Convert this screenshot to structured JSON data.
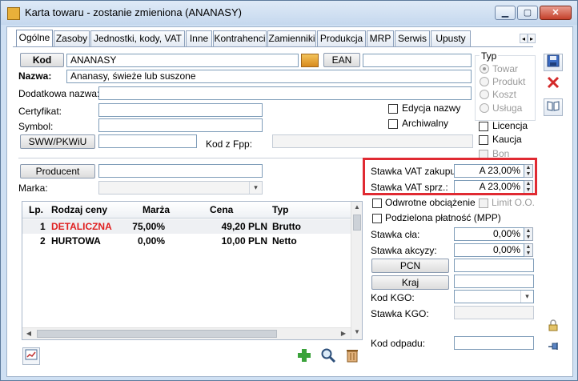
{
  "window": {
    "title": "Karta towaru - zostanie zmieniona (ANANASY)",
    "controls": {
      "minimize": "▁",
      "maximize": "▢",
      "close": "✕"
    }
  },
  "tabs": [
    "Ogólne",
    "Zasoby",
    "Jednostki, kody, VAT",
    "Inne",
    "Kontrahenci",
    "Zamienniki",
    "Produkcja",
    "MRP",
    "Serwis",
    "Upusty"
  ],
  "tab_nav": {
    "left": "◂",
    "right": "▸"
  },
  "form": {
    "kod_button": "Kod",
    "kod_value": "ANANASY",
    "ean_button": "EAN",
    "ean_value": "",
    "nazwa_label": "Nazwa:",
    "nazwa_value": "Ananasy, świeże lub suszone",
    "dodatkowa_label": "Dodatkowa nazwa:",
    "dodatkowa_value": "",
    "certyfikat_label": "Certyfikat:",
    "certyfikat_value": "",
    "symbol_label": "Symbol:",
    "symbol_value": "",
    "sww_button": "SWW/PKWiU",
    "sww_value": "",
    "kodfpp_label": "Kod z Fpp:",
    "kodfpp_value": "",
    "producent_button": "Producent",
    "producent_value": "",
    "marka_label": "Marka:",
    "marka_value": ""
  },
  "typ": {
    "title": "Typ",
    "options": [
      "Towar",
      "Produkt",
      "Koszt",
      "Usługa"
    ],
    "selected": "Towar"
  },
  "checkboxes": {
    "edycja_nazwy": "Edycja nazwy",
    "archiwalny": "Archiwalny",
    "licencja": "Licencja",
    "kaucja": "Kaucja",
    "bon": "Bon",
    "odwrotne": "Odwrotne obciążenie",
    "limit": "Limit O.O.",
    "mpp": "Podzielona płatność (MPP)"
  },
  "vat": {
    "zakupu_label": "Stawka VAT zakupu:",
    "zakupu_value": "A 23,00%",
    "sprz_label": "Stawka VAT sprz.:",
    "sprz_value": "A 23,00%"
  },
  "fields_right": {
    "cla_label": "Stawka cła:",
    "cla_value": "0,00%",
    "akcyzy_label": "Stawka akcyzy:",
    "akcyzy_value": "0,00%",
    "pcn_button": "PCN",
    "pcn_value": "",
    "kraj_button": "Kraj",
    "kraj_value": "",
    "kodkgo_label": "Kod KGO:",
    "kodkgo_value": "",
    "stawkakgo_label": "Stawka KGO:",
    "stawkakgo_value": "",
    "kododpadu_label": "Kod odpadu:",
    "kododpadu_value": ""
  },
  "price_table": {
    "columns": [
      "Lp.",
      "Rodzaj ceny",
      "Marża",
      "Cena",
      "Typ"
    ],
    "rows": [
      {
        "lp": "1",
        "rodzaj": "DETALICZNA",
        "marza": "75,00%",
        "cena": "49,20 PLN",
        "typ": "Brutto"
      },
      {
        "lp": "2",
        "rodzaj": "HURTOWA",
        "marza": "0,00%",
        "cena": "10,00 PLN",
        "typ": "Netto"
      }
    ]
  },
  "icons": {
    "save": "save-icon",
    "delete": "delete-icon",
    "book": "book-icon",
    "add": "add-icon",
    "search": "search-icon",
    "trash": "trash-icon",
    "lock": "lock-icon",
    "pin": "pin-icon"
  },
  "colors": {
    "highlight": "#e02a32",
    "detaliczna": "#e02020",
    "add_green": "#3aa23a"
  }
}
